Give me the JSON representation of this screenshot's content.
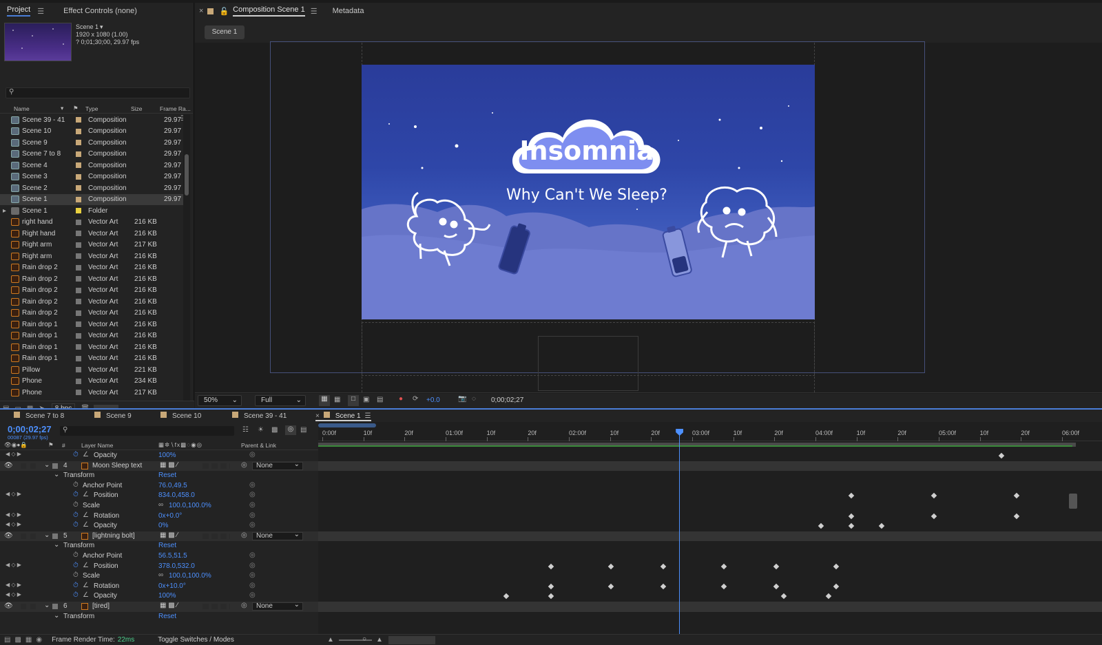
{
  "project": {
    "tabs": [
      "Project",
      "Effect Controls (none)"
    ],
    "comp_name": "Scene 1",
    "comp_res": "1920 x 1080 (1.00)",
    "comp_duration": "? 0;01;30;00, 29.97 fps",
    "columns": [
      "Name",
      "Type",
      "Size",
      "Frame Ra..."
    ],
    "items": [
      {
        "name": "Scene 39 - 41",
        "type": "Composition",
        "size": "",
        "fps": "29.97",
        "icon": "comp",
        "label": "#c8a878"
      },
      {
        "name": "Scene 10",
        "type": "Composition",
        "size": "",
        "fps": "29.97",
        "icon": "comp",
        "label": "#c8a878"
      },
      {
        "name": "Scene 9",
        "type": "Composition",
        "size": "",
        "fps": "29.97",
        "icon": "comp",
        "label": "#c8a878"
      },
      {
        "name": "Scene 7 to 8",
        "type": "Composition",
        "size": "",
        "fps": "29.97",
        "icon": "comp",
        "label": "#c8a878"
      },
      {
        "name": "Scene 4",
        "type": "Composition",
        "size": "",
        "fps": "29.97",
        "icon": "comp",
        "label": "#c8a878"
      },
      {
        "name": "Scene 3",
        "type": "Composition",
        "size": "",
        "fps": "29.97",
        "icon": "comp",
        "label": "#c8a878"
      },
      {
        "name": "Scene 2",
        "type": "Composition",
        "size": "",
        "fps": "29.97",
        "icon": "comp",
        "label": "#c8a878"
      },
      {
        "name": "Scene 1",
        "type": "Composition",
        "size": "",
        "fps": "29.97",
        "icon": "comp",
        "label": "#c8a878"
      },
      {
        "name": "Scene 1",
        "type": "Folder",
        "size": "",
        "fps": "",
        "icon": "fold",
        "label": "#e8d040"
      },
      {
        "name": "right hand",
        "type": "Vector Art",
        "size": "216 KB",
        "fps": "",
        "icon": "vec",
        "label": "#777777"
      },
      {
        "name": "Right hand",
        "type": "Vector Art",
        "size": "216 KB",
        "fps": "",
        "icon": "vec",
        "label": "#777777"
      },
      {
        "name": "Right arm",
        "type": "Vector Art",
        "size": "217 KB",
        "fps": "",
        "icon": "vec",
        "label": "#777777"
      },
      {
        "name": "Right arm",
        "type": "Vector Art",
        "size": "216 KB",
        "fps": "",
        "icon": "vec",
        "label": "#777777"
      },
      {
        "name": "Rain drop 2",
        "type": "Vector Art",
        "size": "216 KB",
        "fps": "",
        "icon": "vec",
        "label": "#777777"
      },
      {
        "name": "Rain drop 2",
        "type": "Vector Art",
        "size": "216 KB",
        "fps": "",
        "icon": "vec",
        "label": "#777777"
      },
      {
        "name": "Rain drop 2",
        "type": "Vector Art",
        "size": "216 KB",
        "fps": "",
        "icon": "vec",
        "label": "#777777"
      },
      {
        "name": "Rain drop 2",
        "type": "Vector Art",
        "size": "216 KB",
        "fps": "",
        "icon": "vec",
        "label": "#777777"
      },
      {
        "name": "Rain drop 2",
        "type": "Vector Art",
        "size": "216 KB",
        "fps": "",
        "icon": "vec",
        "label": "#777777"
      },
      {
        "name": "Rain drop 1",
        "type": "Vector Art",
        "size": "216 KB",
        "fps": "",
        "icon": "vec",
        "label": "#777777"
      },
      {
        "name": "Rain drop 1",
        "type": "Vector Art",
        "size": "216 KB",
        "fps": "",
        "icon": "vec",
        "label": "#777777"
      },
      {
        "name": "Rain drop 1",
        "type": "Vector Art",
        "size": "216 KB",
        "fps": "",
        "icon": "vec",
        "label": "#777777"
      },
      {
        "name": "Rain drop 1",
        "type": "Vector Art",
        "size": "216 KB",
        "fps": "",
        "icon": "vec",
        "label": "#777777"
      },
      {
        "name": "Pillow",
        "type": "Vector Art",
        "size": "221 KB",
        "fps": "",
        "icon": "vec",
        "label": "#777777"
      },
      {
        "name": "Phone",
        "type": "Vector Art",
        "size": "234 KB",
        "fps": "",
        "icon": "vec",
        "label": "#777777"
      },
      {
        "name": "Phone",
        "type": "Vector Art",
        "size": "217 KB",
        "fps": "",
        "icon": "vec",
        "label": "#777777"
      }
    ],
    "bpc": "8 bpc"
  },
  "composition": {
    "tab_title": "Composition Scene 1",
    "metadata_tab": "Metadata",
    "scene_button": "Scene 1",
    "title_text": "Insomnia",
    "subtitle_text": "Why Can't We Sleep?",
    "zoom": "50%",
    "resolution": "Full",
    "exposure": "+0.0",
    "timecode": "0;00;02;27"
  },
  "timeline": {
    "tabs": [
      "Scene 7 to 8",
      "Scene 9",
      "Scene 10",
      "Scene 39 - 41",
      "Scene 1"
    ],
    "current_time": "0;00;02;27",
    "frame_info": "00087 (29.97 fps)",
    "col_layer_name": "Layer Name",
    "col_parent": "Parent & Link",
    "col_num": "#",
    "ruler": [
      "0:00f",
      "10f",
      "20f",
      "01:00f",
      "10f",
      "20f",
      "02:00f",
      "10f",
      "20f",
      "03:00f",
      "10f",
      "20f",
      "04:00f",
      "10f",
      "20f",
      "05:00f",
      "10f",
      "20f",
      "06:00f"
    ],
    "playhead_fraction": 0.48,
    "rows": [
      {
        "kind": "prop",
        "name": "Opacity",
        "value": "100%",
        "stopwatch": true
      },
      {
        "kind": "layer",
        "num": "4",
        "name": "Moon Sleep text",
        "parent": "None"
      },
      {
        "kind": "group",
        "name": "Transform",
        "value": "Reset"
      },
      {
        "kind": "prop",
        "name": "Anchor Point",
        "value": "76.0,49.5"
      },
      {
        "kind": "prop",
        "name": "Position",
        "value": "834.0,458.0",
        "stopwatch": true
      },
      {
        "kind": "prop",
        "name": "Scale",
        "value": "100.0,100.0%",
        "link": true
      },
      {
        "kind": "prop",
        "name": "Rotation",
        "value": "0x+0.0°",
        "stopwatch": true
      },
      {
        "kind": "prop",
        "name": "Opacity",
        "value": "0%",
        "stopwatch": true
      },
      {
        "kind": "layer",
        "num": "5",
        "name": "[lightning bolt]",
        "parent": "None"
      },
      {
        "kind": "group",
        "name": "Transform",
        "value": "Reset"
      },
      {
        "kind": "prop",
        "name": "Anchor Point",
        "value": "56.5,51.5"
      },
      {
        "kind": "prop",
        "name": "Position",
        "value": "378.0,532.0",
        "stopwatch": true
      },
      {
        "kind": "prop",
        "name": "Scale",
        "value": "100.0,100.0%",
        "link": true
      },
      {
        "kind": "prop",
        "name": "Rotation",
        "value": "0x+10.0°",
        "stopwatch": true
      },
      {
        "kind": "prop",
        "name": "Opacity",
        "value": "100%",
        "stopwatch": true
      },
      {
        "kind": "layer",
        "num": "6",
        "name": "[tired]",
        "parent": "None"
      },
      {
        "kind": "group",
        "name": "Transform",
        "value": "Reset"
      }
    ],
    "keyframes": [
      [
        0.91
      ],
      [],
      [],
      [],
      [
        0.71,
        0.82,
        0.93
      ],
      [],
      [
        0.71,
        0.82,
        0.93
      ],
      [
        0.67,
        0.71,
        0.75
      ],
      [],
      [],
      [],
      [
        0.31,
        0.39,
        0.46,
        0.54,
        0.61,
        0.69
      ],
      [],
      [
        0.31,
        0.39,
        0.46,
        0.54,
        0.61,
        0.69
      ],
      [
        0.25,
        0.31,
        0.62,
        0.68
      ],
      [],
      []
    ],
    "frame_render_label": "Frame Render Time:",
    "frame_render_value": "22ms",
    "toggle_label": "Toggle Switches / Modes"
  }
}
